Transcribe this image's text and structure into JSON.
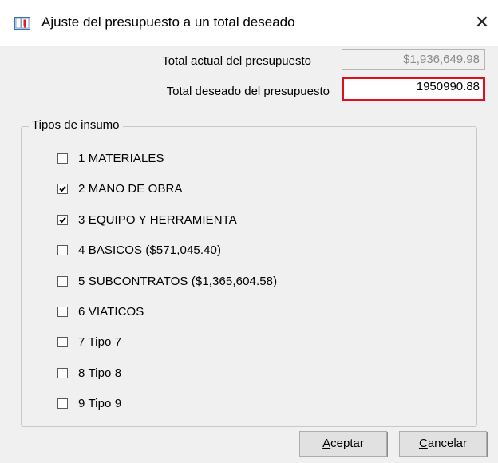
{
  "window": {
    "title": "Ajuste del presupuesto a un total deseado",
    "close_glyph": "✕"
  },
  "totals": {
    "actual_label": "Total actual del presupuesto",
    "actual_value": "$1,936,649.98",
    "deseado_label": "Total deseado del presupuesto",
    "deseado_value": "1950990.88"
  },
  "group": {
    "title": "Tipos de insumo",
    "items": [
      {
        "label": "1 MATERIALES",
        "checked": false
      },
      {
        "label": "2 MANO DE OBRA",
        "checked": true
      },
      {
        "label": "3 EQUIPO Y HERRAMIENTA",
        "checked": true
      },
      {
        "label": "4 BASICOS ($571,045.40)",
        "checked": false
      },
      {
        "label": "5 SUBCONTRATOS ($1,365,604.58)",
        "checked": false
      },
      {
        "label": "6 VIATICOS",
        "checked": false
      },
      {
        "label": "7 Tipo 7",
        "checked": false
      },
      {
        "label": "8 Tipo 8",
        "checked": false
      },
      {
        "label": "9 Tipo 9",
        "checked": false
      }
    ]
  },
  "buttons": {
    "accept": {
      "mnemonic": "A",
      "rest": "ceptar"
    },
    "cancel": {
      "mnemonic": "C",
      "rest": "ancelar"
    }
  },
  "colors": {
    "highlight_border": "#e0101a",
    "dialog_bg": "#f0f0f0",
    "disabled_text": "#8a8a8a"
  },
  "icons": {
    "app": "budget-app-icon",
    "close": "close-icon",
    "check": "checkmark-icon"
  }
}
